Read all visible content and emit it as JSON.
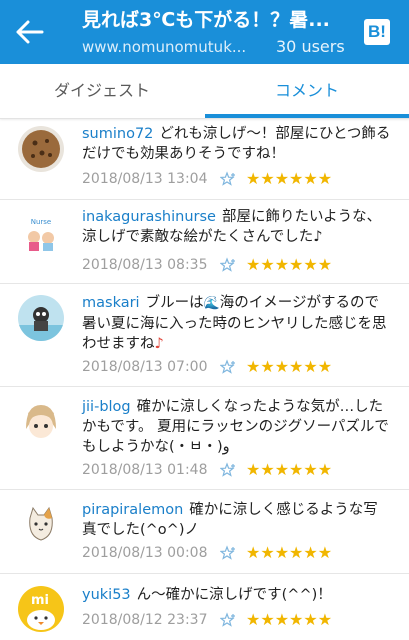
{
  "appbar": {
    "title": "見れば3℃も下がる！？暑...",
    "url": "www.nomunomutuk...",
    "users": "30 users",
    "hatena_icon_label": "B!"
  },
  "tabs": [
    {
      "label": "ダイジェスト",
      "active": false
    },
    {
      "label": "コメント",
      "active": true
    }
  ],
  "colors": {
    "accent": "#1a8fd9",
    "star": "#f1b600",
    "username": "#1a7fc9"
  },
  "comments": [
    {
      "user": "sumino72",
      "text": "どれも涼しげ〜！部屋にひとつ飾るだけでも効果ありそうですね！",
      "date": "2018/08/13 13:04",
      "stars": "★★★★★★"
    },
    {
      "user": "inakagurashinurse",
      "text": "部屋に飾りたいような、涼しげで素敵な絵がたくさんでした♪",
      "date": "2018/08/13 08:35",
      "stars": "★★★★★★"
    },
    {
      "user": "maskari",
      "text_before": "ブルーは",
      "emoji": "🌊",
      "text_after": "海のイメージがするので暑い夏に海に入った時のヒンヤリした感じを思わせますね",
      "note": "♪",
      "date": "2018/08/13 07:00",
      "stars": "★★★★★★"
    },
    {
      "user": "jii-blog",
      "text": "確かに涼しくなったような気が…したかもです。 夏用にラッセンのジグソーパズルでもしようかな(・ㅂ・)و",
      "date": "2018/08/13 01:48",
      "stars": "★★★★★★"
    },
    {
      "user": "pirapiralemon",
      "text": "確かに涼しく感じるような写真でした(^o^)ノ",
      "date": "2018/08/13 00:08",
      "stars": "★★★★★★"
    },
    {
      "user": "yuki53",
      "text": "ん〜確かに涼しげです(^^)！",
      "date": "2018/08/12 23:37",
      "stars": "★★★★★★"
    }
  ]
}
